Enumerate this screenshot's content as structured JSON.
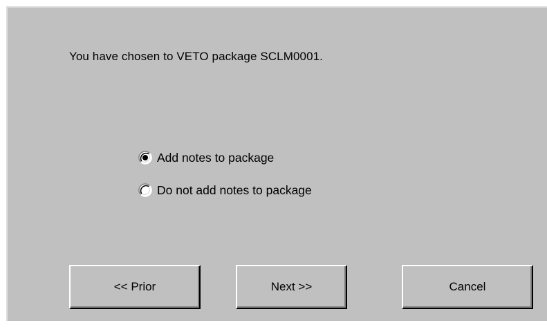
{
  "dialog": {
    "message": "You have chosen to VETO package SCLM0001."
  },
  "options": [
    {
      "label": "Add notes to package",
      "selected": true
    },
    {
      "label": "Do not add notes to package",
      "selected": false
    }
  ],
  "buttons": {
    "prior_label": "<< Prior",
    "next_label": "Next >>",
    "cancel_label": "Cancel"
  },
  "colors": {
    "face": "#c0c0c0",
    "highlight": "#ffffff",
    "shadow": "#808080",
    "dark_shadow": "#000000"
  }
}
